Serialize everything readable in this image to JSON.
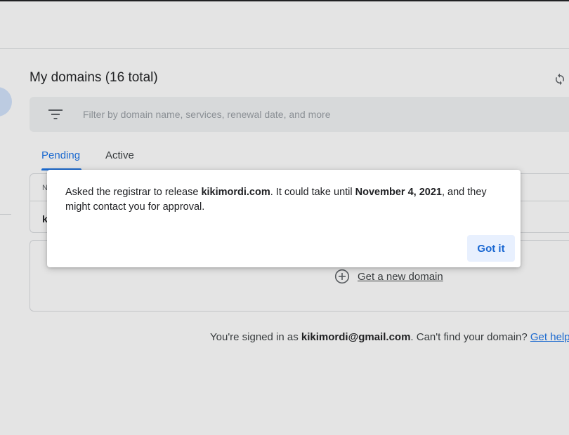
{
  "main": {
    "title": "My domains (16 total)",
    "filter_placeholder": "Filter by domain name, services, renewal date, and more",
    "tabs": [
      {
        "label": "Pending",
        "selected": true
      },
      {
        "label": "Active",
        "selected": false
      }
    ],
    "table": {
      "header_first_cell": "N",
      "rows": [
        {
          "first_cell": "k"
        }
      ]
    },
    "new_domain_label": "Get a new domain"
  },
  "footer": {
    "prefix": "You're signed in as ",
    "email": "kikimordi@gmail.com",
    "middle": ". Can't find your domain? ",
    "help_link": "Get help"
  },
  "dialog": {
    "part1": "Asked the registrar to release ",
    "domain": "kikimordi.com",
    "part2": ". It could take until ",
    "date": "November 4, 2021",
    "part3": ", and they might contact you for approval.",
    "button_label": "Got it"
  },
  "icons": {
    "refresh": "refresh-icon",
    "filter": "filter-icon",
    "add": "add-circle-icon"
  },
  "colors": {
    "accent": "#1a73e8",
    "button_bg": "#e8f0fe",
    "button_text": "#1967d2"
  }
}
